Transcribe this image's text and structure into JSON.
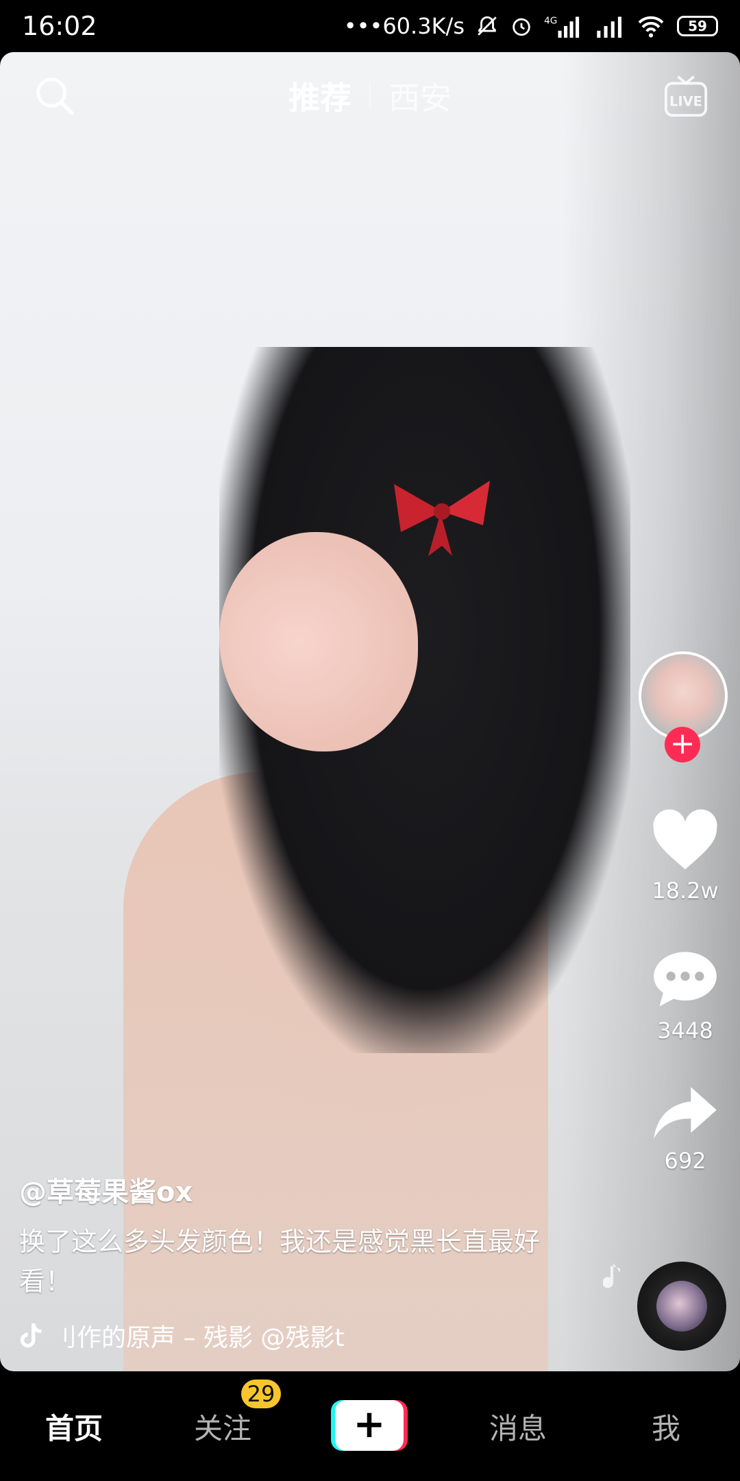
{
  "status_bar": {
    "time": "16:02",
    "net_speed": "•••60.3K/s",
    "battery": "59"
  },
  "top_nav": {
    "tabs": [
      {
        "label": "推荐",
        "active": true
      },
      {
        "label": "西安",
        "active": false
      }
    ],
    "search_icon": "search-icon",
    "live_icon": "live-icon"
  },
  "video": {
    "author": "@草莓果酱ox",
    "description": "换了这么多头发颜色！我还是感觉黑长直最好看！",
    "music": "刂作的原声 – 残影    @残影t"
  },
  "actions": {
    "likes": "18.2w",
    "comments": "3448",
    "shares": "692"
  },
  "bottom_nav": {
    "items": [
      {
        "label": "首页",
        "active": true
      },
      {
        "label": "关注",
        "active": false
      },
      {
        "label": "消息",
        "active": false
      },
      {
        "label": "我",
        "active": false
      }
    ],
    "follow_badge": "29",
    "create_label": "+"
  },
  "colors": {
    "accent": "#fe2c55",
    "cyan": "#25f4ee",
    "badge": "#f7c62c"
  }
}
